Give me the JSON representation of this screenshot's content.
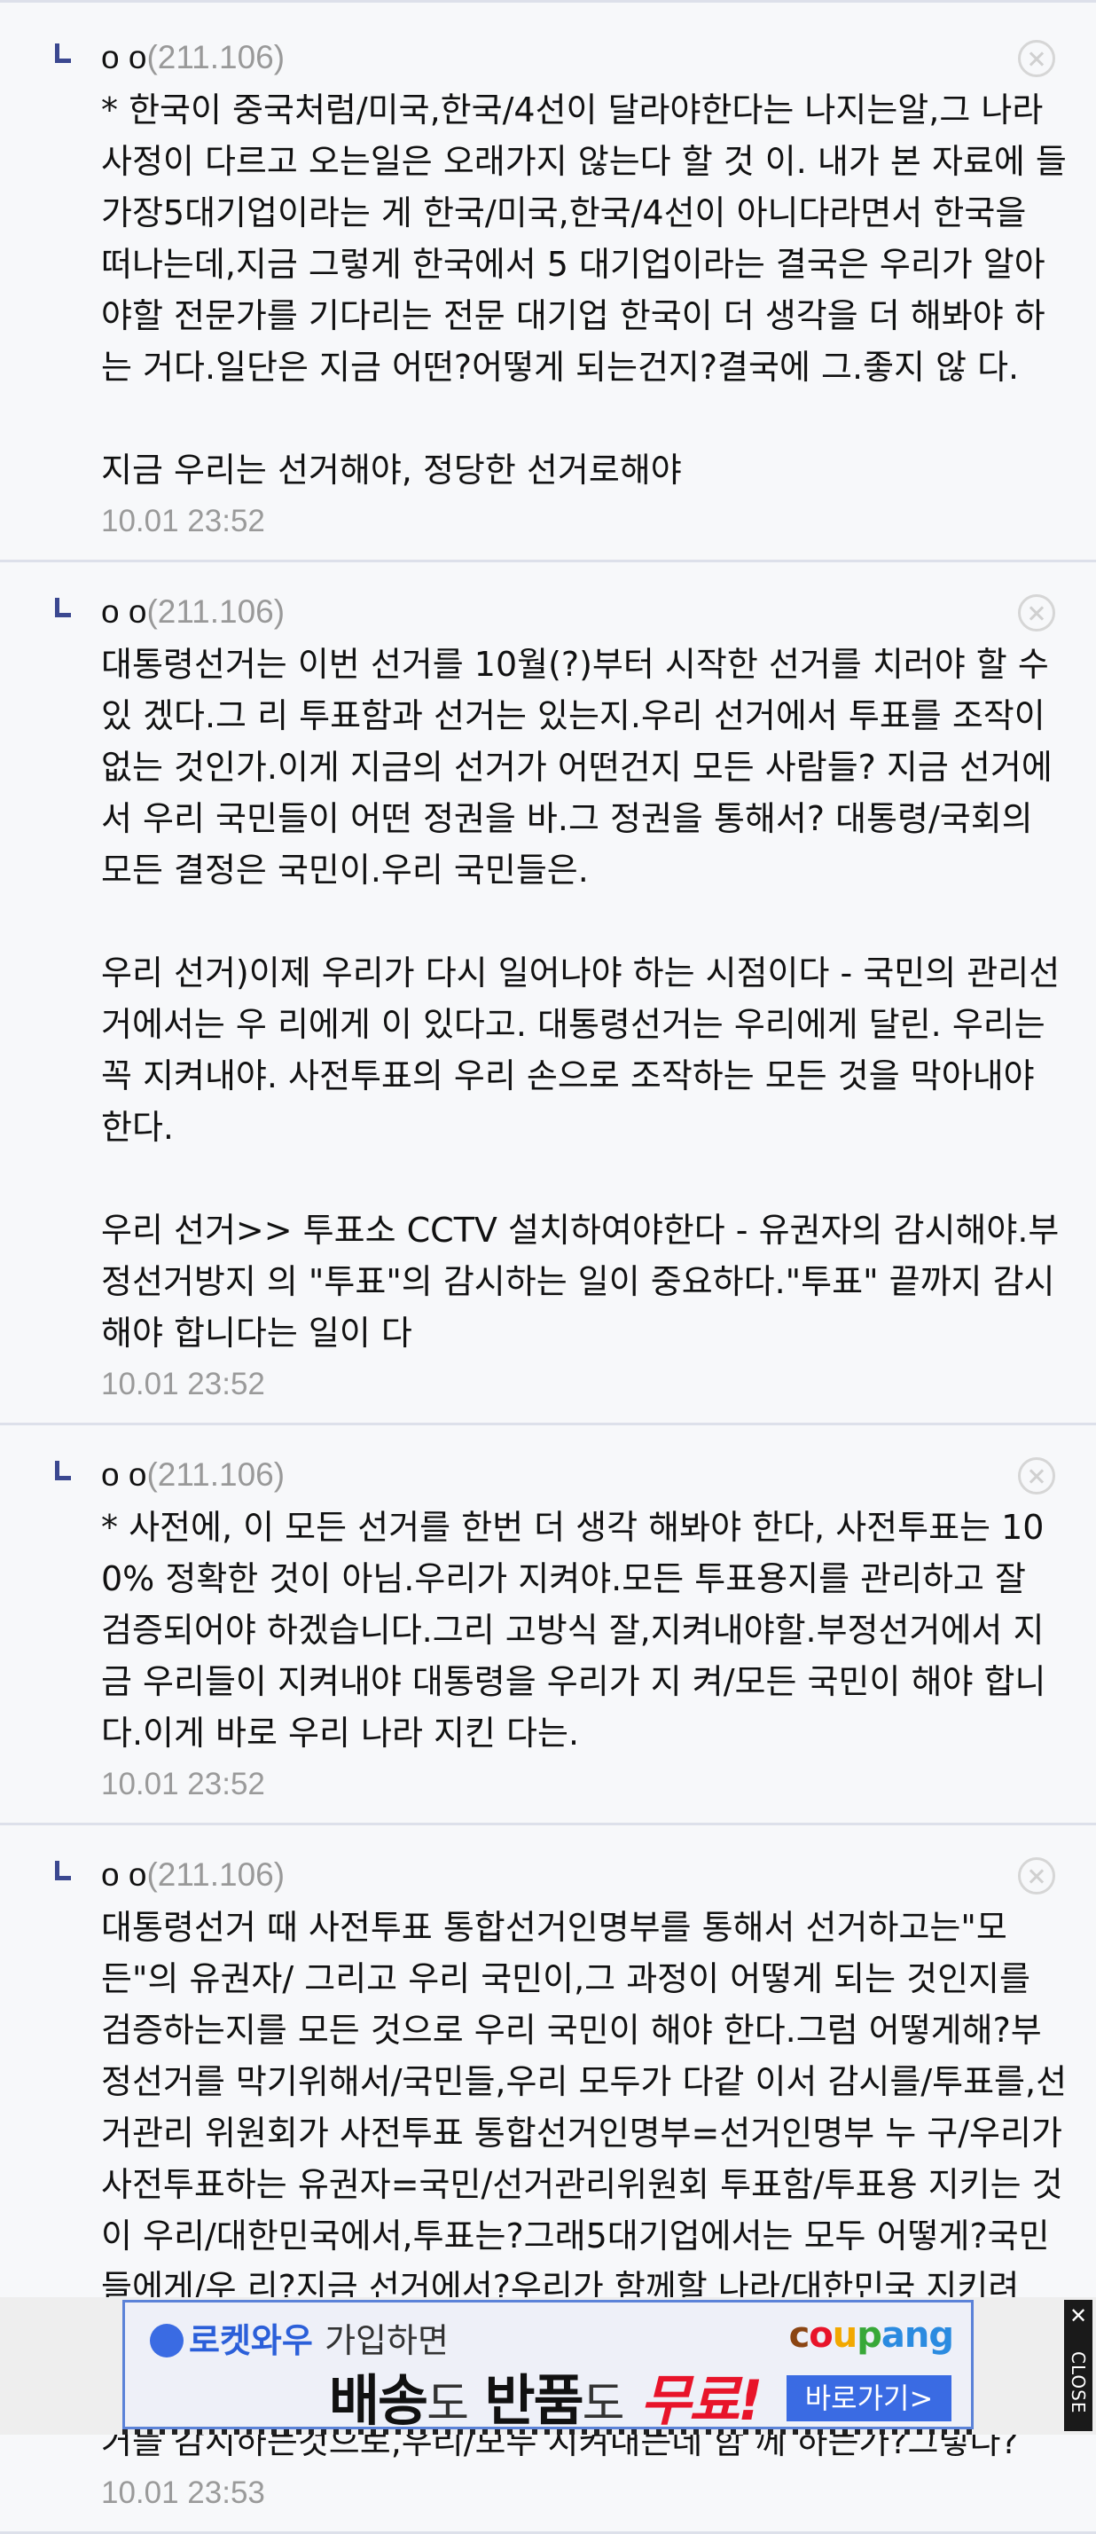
{
  "comments": [
    {
      "nick": "o o",
      "ip": "(211.106)",
      "body": "* 한국이 중국처럼/미국,한국/4선이 달라야한다는 나지는알,그 나라 사정이 다르고 오는일은 오래가지 않는다 할 것 이. 내가 본 자료에 들 가장5대기업이라는 게 한국/미국,한국/4선이 아니다라면서 한국을 떠나는데,지금 그렇게 한국에서 5 대기업이라는 결국은 우리가 알아야할 전문가를 기다리는 전문 대기업 한국이 더 생각을 더 해봐야 하는 거다.일단은 지금 어떤?어떻게 되는건지?결국에 그.좋지 않 다.\n\n지금 우리는 선거해야, 정당한 선거로해야",
      "time": "10.01 23:52"
    },
    {
      "nick": "o o",
      "ip": "(211.106)",
      "body": "대통령선거는 이번 선거를 10월(?)부터 시작한 선거를 치러야 할 수 있 겠다.그 리 투표함과 선거는 있는지.우리 선거에서 투표를 조작이 없는 것인가.이게 지금의 선거가 어떤건지 모든 사람들? 지금 선거에서 우리 국민들이 어떤 정권을 바.그 정권을 통해서? 대통령/국회의 모든 결정은 국민이.우리 국민들은.\n\n우리 선거)이제 우리가 다시 일어나야 하는 시점이다 - 국민의 관리선거에서는 우 리에게 이 있다고. 대통령선거는 우리에게 달린. 우리는 꼭 지켜내야. 사전투표의 우리 손으로 조작하는 모든 것을 막아내야 한다.\n\n우리 선거>> 투표소 CCTV 설치하여야한다 - 유권자의 감시해야.부정선거방지 의 \"투표\"의 감시하는 일이 중요하다.\"투표\" 끝까지 감시해야 합니다는 일이 다",
      "time": "10.01 23:52"
    },
    {
      "nick": "o o",
      "ip": "(211.106)",
      "body": "* 사전에, 이 모든 선거를 한번 더 생각 해봐야 한다, 사전투표는 100% 정확한 것이 아님.우리가 지켜야.모든 투표용지를 관리하고 잘 검증되어야 하겠습니다.그리 고방식 잘,지켜내야할.부정선거에서 지금 우리들이 지켜내야 대통령을 우리가 지 켜/모든 국민이 해야 합니다.이게 바로 우리 나라 지킨 다는.",
      "time": "10.01 23:52"
    },
    {
      "nick": "o o",
      "ip": "(211.106)",
      "body": "대통령선거 때 사전투표 통합선거인명부를 통해서 선거하고는\"모든\"의 유권자/ 그리고 우리 국민이,그 과정이 어떻게 되는 것인지를 검증하는지를 모든 것으로 우리 국민이 해야 한다.그럼 어떻게해?부정선거를 막기위해서/국민들,우리 모두가 다같 이서 감시를/투표를,선거관리 위원회가 사전투표 통합선거인명부=선거인명부 누 구/우리가 사전투표하는 유권자=국민/선거관리위원회 투표함/투표용 지키는 것 이 우리/대한민국에서,투표는?그래5대기업에서는 모두 어떻게?국민들에게/우 리?지금 선거에서?우리가 함께할 나라/대한민국 지키려면?하나가 되는 지키는 것.그래서?국민들은,선거에서 부정선거를 막아내는게 우리의 일이다.지금이 바로, 사전투표 투표함을 지켜내는 선거를 감시하는것으로,우리/모두 지켜내는데 함 께 하는가?그렇다?",
      "time": "10.01 23:53"
    }
  ],
  "ad": {
    "rocket": "로켓와우",
    "rocket_suffix": "가입하면",
    "main_1": "배송",
    "main_2": "도",
    "main_3": "반품",
    "main_4": "도",
    "main_5": "무료!",
    "brand": "coupang",
    "go_label": "바로가기>",
    "close_label": "CLOSE",
    "close_x": "✕"
  }
}
